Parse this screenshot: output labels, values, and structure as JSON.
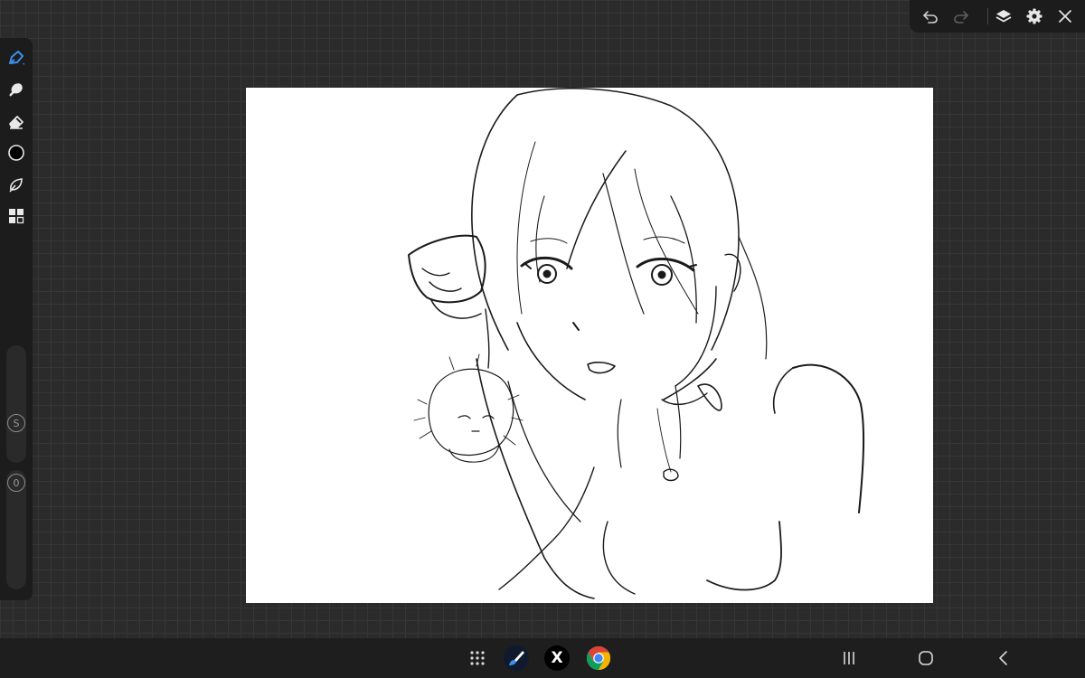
{
  "app": {
    "accent_color": "#3d8fef"
  },
  "left_toolbar": {
    "tools": [
      {
        "id": "brush",
        "icon": "brush-pen-icon",
        "active": true
      },
      {
        "id": "smudge",
        "icon": "smudge-icon"
      },
      {
        "id": "eraser",
        "icon": "eraser-icon"
      },
      {
        "id": "color",
        "icon": "color-circle-icon",
        "color": "#000000"
      },
      {
        "id": "selection",
        "icon": "lasso-icon"
      },
      {
        "id": "grid-tools",
        "icon": "grid-icon"
      }
    ],
    "size_slider": {
      "label": "S"
    },
    "opacity_slider": {
      "label": "0"
    }
  },
  "top_toolbar": {
    "buttons": [
      "undo-icon",
      "redo-icon",
      "layers-icon",
      "settings-icon",
      "close-icon"
    ]
  },
  "canvas": {
    "background": "#ffffff",
    "stroke_color": "#1a1a1a"
  },
  "taskbar": {
    "apps": [
      "app-drawer-icon",
      "ibis-paint-icon",
      "x-app-icon",
      "chrome-icon"
    ],
    "x_app_letter": "X",
    "nav": [
      "recents-icon",
      "home-icon",
      "back-icon"
    ]
  }
}
